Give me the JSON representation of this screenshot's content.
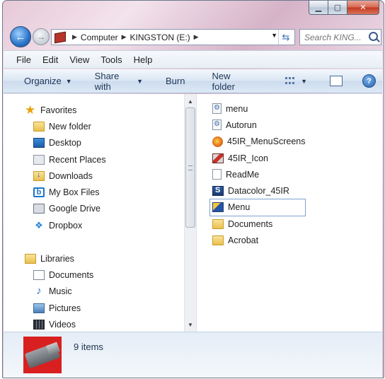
{
  "address": {
    "crumbs": [
      "Computer",
      "KINGSTON (E:)"
    ],
    "search_placeholder": "Search KING..."
  },
  "menu": [
    "File",
    "Edit",
    "View",
    "Tools",
    "Help"
  ],
  "commands": {
    "organize": "Organize",
    "share_with": "Share with",
    "burn": "Burn",
    "new_folder": "New folder",
    "help": "?"
  },
  "favorites": {
    "label": "Favorites",
    "items": [
      "New folder",
      "Desktop",
      "Recent Places",
      "Downloads",
      "My Box Files",
      "Google Drive",
      "Dropbox"
    ]
  },
  "libraries": {
    "label": "Libraries",
    "items": [
      "Documents",
      "Music",
      "Pictures",
      "Videos"
    ]
  },
  "files": [
    "menu",
    "Autorun",
    "45IR_MenuScreens",
    "45IR_Icon",
    "ReadMe",
    "Datacolor_45IR",
    "Menu",
    "Documents",
    "Acrobat"
  ],
  "status": {
    "item_count": "9 items"
  }
}
